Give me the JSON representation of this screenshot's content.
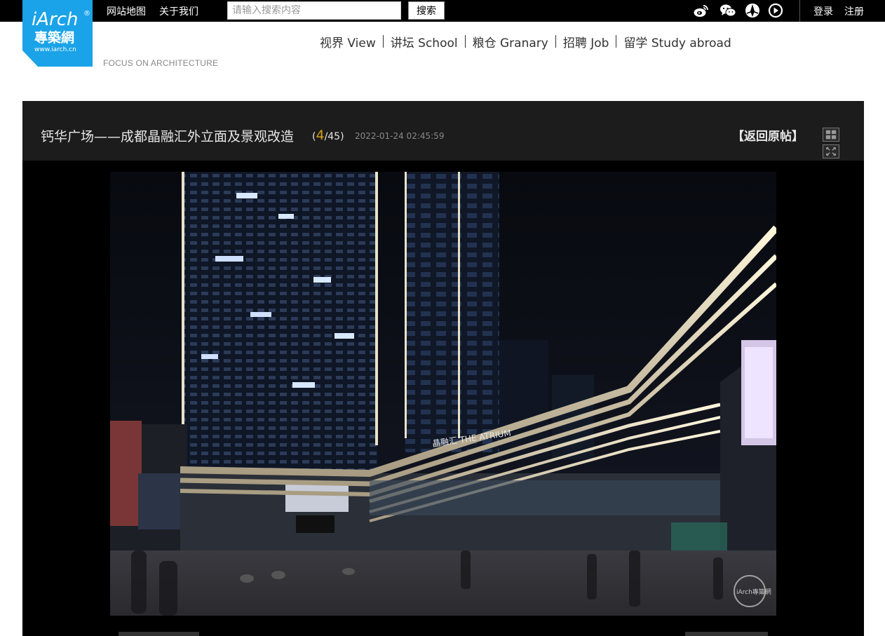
{
  "topbar": {
    "links": [
      "网站地图",
      "关于我们"
    ],
    "search_placeholder": "请输入搜索内容",
    "search_button": "搜索",
    "social_icons": [
      "weibo-icon",
      "wechat-icon",
      "camera-aperture-icon",
      "play-circle-icon"
    ],
    "login": "登录",
    "register": "注册"
  },
  "logo": {
    "text_top": "iArch",
    "text_main": "專築網",
    "text_url": "www.iarch.cn",
    "registered": "®",
    "slogan": "FOCUS ON ARCHITECTURE",
    "color": "#1aa3e8"
  },
  "nav": [
    {
      "label": "视界 View"
    },
    {
      "label": "讲坛 School"
    },
    {
      "label": "粮仓 Granary"
    },
    {
      "label": "招聘 Job"
    },
    {
      "label": "留学 Study abroad"
    }
  ],
  "viewer": {
    "title": "钙华广场——成都晶融汇外立面及景观改造",
    "current": "4",
    "total": "/45",
    "date": "2022-01-24 02:45:59",
    "back_label": "【返回原帖】",
    "photo_alt": "Night view of The Atrium facade with illuminated white bands",
    "watermark": "iArch專築網"
  }
}
